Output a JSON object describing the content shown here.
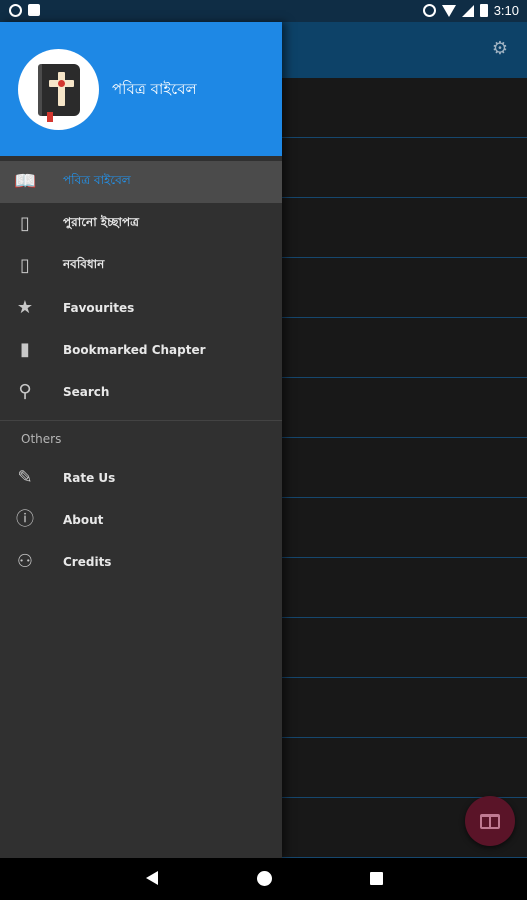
{
  "status_bar": {
    "time": "3:10",
    "icons": [
      "notification-icon",
      "sim-icon",
      "alarm-icon",
      "wifi-icon",
      "signal-icon",
      "battery-icon"
    ]
  },
  "app_bar": {
    "settings_icon": "gear-icon"
  },
  "drawer": {
    "header": {
      "title": "পবিত্র বাইবেল",
      "logo": "bible-cross-icon"
    },
    "items": [
      {
        "label": "পবিত্র বাইবেল",
        "icon": "open-book-icon",
        "glyph": "📖",
        "active": true
      },
      {
        "label": "পুরানো ইচ্ছাপত্র",
        "icon": "book-left-icon",
        "glyph": "▯",
        "active": false
      },
      {
        "label": "নববিধান",
        "icon": "book-right-icon",
        "glyph": "▯",
        "active": false
      },
      {
        "label": "Favourites",
        "icon": "star-icon",
        "glyph": "★",
        "active": false
      },
      {
        "label": "Bookmarked Chapter",
        "icon": "bookmark-icon",
        "glyph": "▮",
        "active": false
      },
      {
        "label": "Search",
        "icon": "search-icon",
        "glyph": "⚲",
        "active": false
      }
    ],
    "section_title": "Others",
    "other_items": [
      {
        "label": "Rate Us",
        "icon": "rate-icon",
        "glyph": "✎"
      },
      {
        "label": "About",
        "icon": "info-icon",
        "glyph": "ⓘ"
      },
      {
        "label": "Credits",
        "icon": "person-icon",
        "glyph": "⚇"
      }
    ]
  },
  "fab": {
    "icon": "book-icon"
  },
  "colors": {
    "header": "#1e88e5",
    "app_bar": "#0d4268",
    "drawer": "#303030",
    "active": "#2196f3",
    "fab": "#5a1428"
  }
}
